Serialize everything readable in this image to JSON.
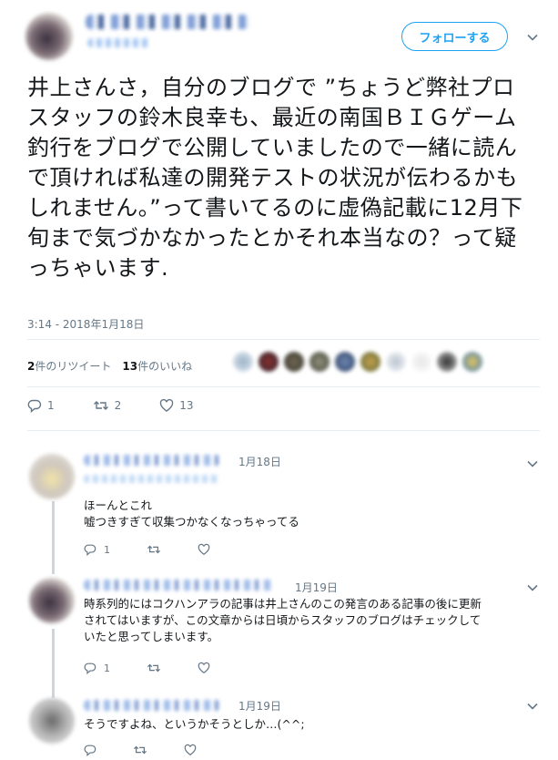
{
  "main": {
    "follow_label": "フォローする",
    "text": "井上さんさ，自分のブログで ”ちょうど弊社プロスタッフの鈴木良幸も、最近の南国ＢＩＧゲーム釣行をブログで公開していましたので一緒に読んで頂ければ私達の開発テストの状況が伝わるかもしれません。”って書いてるのに虚偽記載に12月下旬まで気づかなかったとかそれ本当なの？って疑っちゃいます.",
    "timestamp": "3:14 - 2018年1月18日",
    "retweets_count": "2",
    "retweets_label": "件のリツイート",
    "likes_count": "13",
    "likes_label": "件のいいね",
    "reply_count": "1",
    "retweet_count_action": "2",
    "like_count_action": "13"
  },
  "replies": [
    {
      "date": "1月18日",
      "line1": "ほーんとこれ",
      "line2": "嘘つきすぎて収集つかなくなっちゃってる",
      "reply_count": "1"
    },
    {
      "date": "1月19日",
      "line1": "時系列的にはコクハンアラの記事は井上さんのこの発言のある記事の後に更新",
      "line2": "されてはいますが、この文章からは日頃からスタッフのブログはチェックして",
      "line3": "いたと思ってしまいます。",
      "reply_count": "1"
    },
    {
      "date": "1月19日",
      "line1": "そうですよね、というかそうとしか…(^^;"
    }
  ],
  "icons": [
    "chevron-down-icon",
    "reply-icon",
    "retweet-icon",
    "heart-icon"
  ],
  "colors": {
    "accent": "#1da1f2",
    "muted": "#657786",
    "text": "#14171a",
    "divider": "#e6ecf0",
    "thread": "#ccd6dd"
  }
}
